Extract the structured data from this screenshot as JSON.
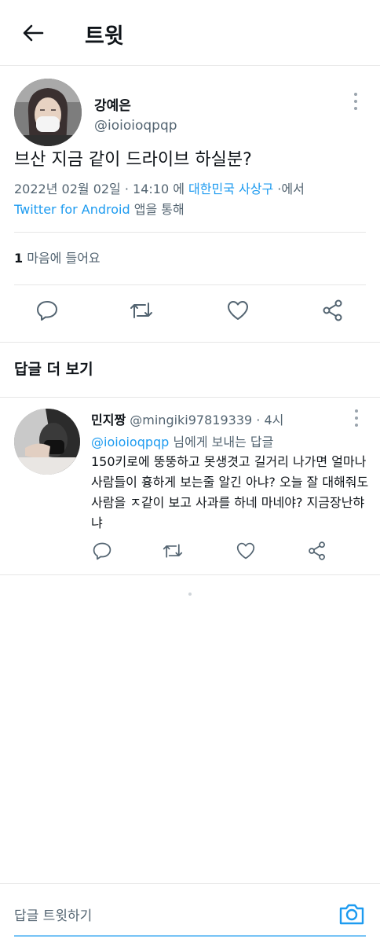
{
  "header": {
    "title": "트윗"
  },
  "tweet": {
    "author_name": "강예은",
    "author_handle": "@ioioioqpqp",
    "text": "브산 지금 같이 드라이브 하실분?",
    "date": "2022년 02월 02일 · 14:10 에",
    "location": "대한민국 사상구",
    "location_suffix": "·에서",
    "client": "Twitter for Android",
    "client_suffix": "앱을 통해",
    "likes_count": "1",
    "likes_label": "마음에 들어요"
  },
  "section": {
    "more_replies": "답글 더 보기"
  },
  "reply": {
    "name": "민지짱",
    "handle": "@mingiki97819339",
    "time": "· 4시",
    "to_handle": "@ioioioqpqp",
    "to_suffix": "님에게 보내는 답글",
    "text": "150키로에 뚱뚱하고 못생겻고 길거리 나가면 얼마나 사람들이 흉하게 보는줄 알긴 아냐? 오늘 잘 대해줘도 사람을 ㅈ같이 보고 사과를 하네 마네야? 지금장난햐냐"
  },
  "compose": {
    "placeholder": "답글 트윗하기"
  },
  "icons": [
    "back-arrow-icon",
    "more-vertical-icon",
    "reply-icon",
    "retweet-icon",
    "like-icon",
    "share-icon",
    "camera-icon"
  ],
  "colors": {
    "link": "#1d9bf0",
    "muted": "#536471",
    "text": "#0f1419",
    "divider": "#e6e6e6"
  }
}
